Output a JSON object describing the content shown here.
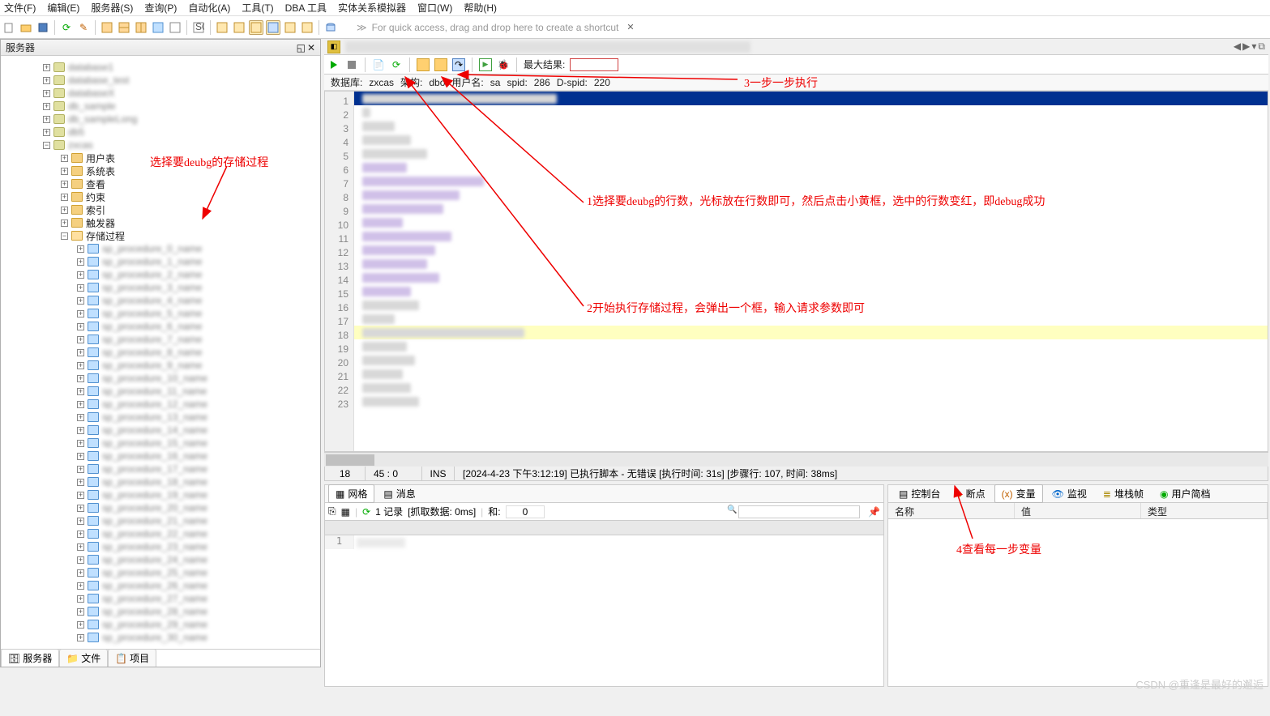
{
  "menu": {
    "file": "文件(F)",
    "edit": "编辑(E)",
    "server": "服务器(S)",
    "query": "查询(P)",
    "auto": "自动化(A)",
    "tools": "工具(T)",
    "dba": "DBA 工具",
    "erm": "实体关系模拟器",
    "window": "窗口(W)",
    "help": "帮助(H)"
  },
  "hint": "For quick access, drag and drop here to create a shortcut",
  "left": {
    "title": "服务器",
    "folders": {
      "user_tables": "用户表",
      "system_tables": "系统表",
      "views": "查看",
      "constraints": "约束",
      "indexes": "索引",
      "triggers": "触发器",
      "procs": "存储过程"
    },
    "bottom_tabs": {
      "server": "服务器",
      "file": "文件",
      "project": "项目"
    }
  },
  "editor": {
    "toolbar": {
      "max_result_label": "最大结果:"
    },
    "info": {
      "db_lbl": "数据库:",
      "db": "zxcas",
      "schema_lbl": "架构:",
      "schema": "dbo",
      "user_lbl": "用户名:",
      "user": "sa",
      "spid_lbl": "spid:",
      "spid": "286",
      "dspid_lbl": "D-spid:",
      "dspid": "220"
    },
    "line_count": 23,
    "status": {
      "row": "18",
      "colpos": "45 : 0",
      "mode": "INS",
      "msg": "[2024-4-23 下午3:12:19] 已执行脚本 - 无错误 [执行时间: 31s]  [步骤行: 107, 时间: 38ms]"
    }
  },
  "bp1": {
    "tabs": {
      "grid": "网格",
      "msg": "消息"
    },
    "bar": {
      "rec": "1 记录",
      "fetch": "[抓取数据: 0ms]",
      "sum_lbl": "和:",
      "sum": "0"
    },
    "rownum": "1"
  },
  "bp2": {
    "tabs": {
      "console": "控制台",
      "bp": "断点",
      "vars": "变量",
      "watch": "监视",
      "stack": "堆栈帧",
      "profile": "用户简档"
    },
    "cols": {
      "name": "名称",
      "value": "值",
      "type": "类型"
    }
  },
  "annotations": {
    "a0": "选择要deubg的存储过程",
    "a1": "1选择要deubg的行数，光标放在行数即可，然后点击小黄框，选中的行数变红，即debug成功",
    "a2": "2开始执行存储过程，会弹出一个框，输入请求参数即可",
    "a3": "3一步一步执行",
    "a4": "4查看每一步变量"
  },
  "watermark": "CSDN @重逢是最好的邂逅"
}
